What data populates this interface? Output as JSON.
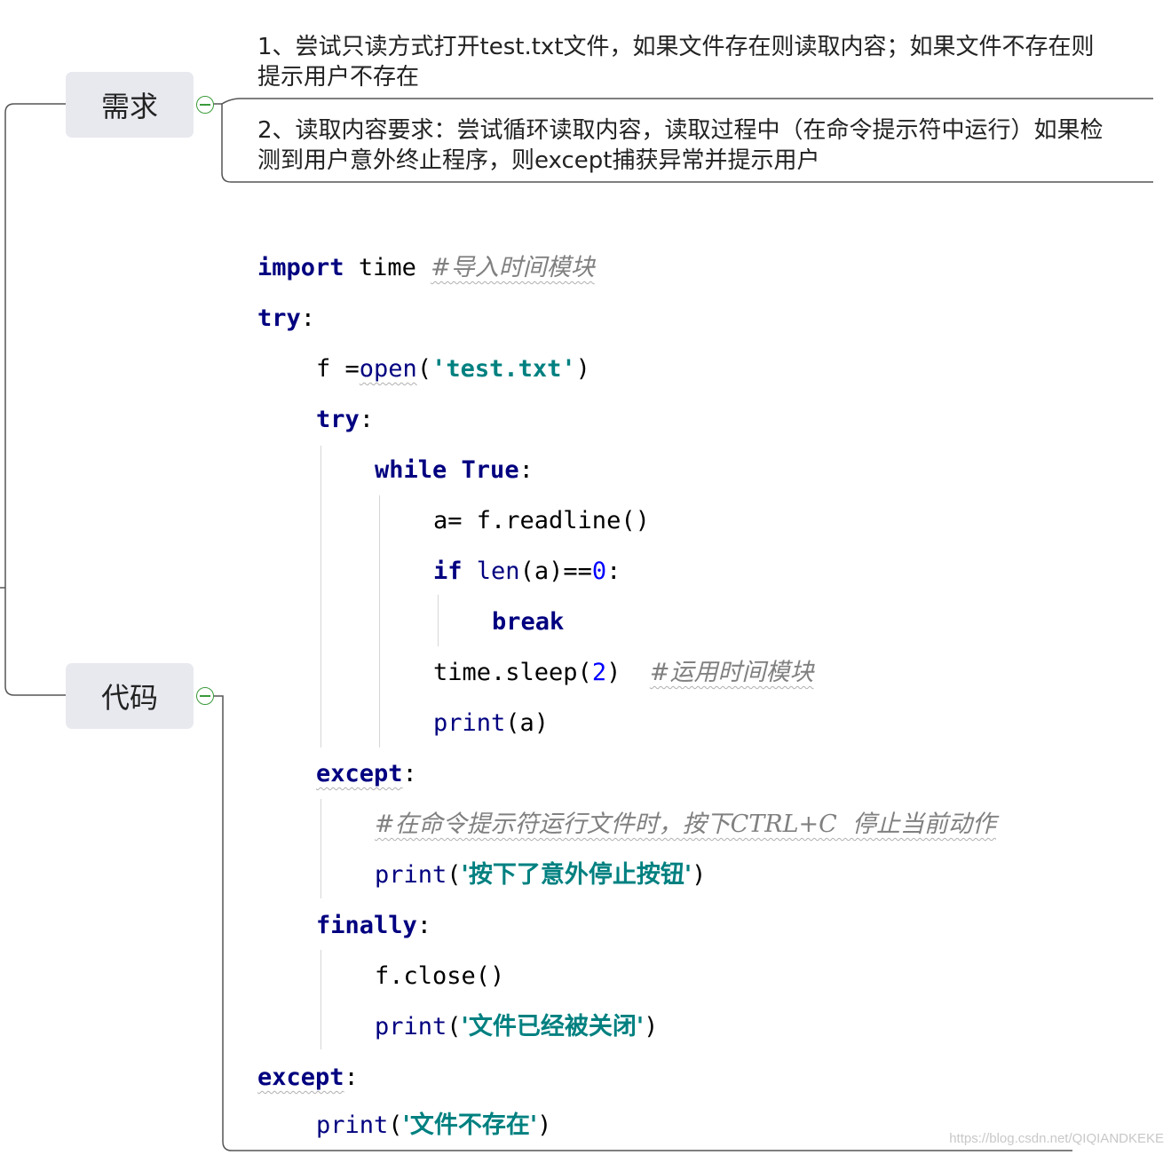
{
  "nodes": {
    "requirements": "需求",
    "code": "代码"
  },
  "requirements": {
    "item1_line1": "1、尝试只读方式打开test.txt文件，如果文件存在则读取内容；如果文件不存在则",
    "item1_line2": "提示用户不存在",
    "item2_line1": "2、读取内容要求：尝试循环读取内容，读取过程中（在命令提示符中运行）如果检",
    "item2_line2": "测到用户意外终止程序，则except捕获异常并提示用户"
  },
  "code": {
    "l1": {
      "kw": "import",
      "mod": "time",
      "comment": "#导入时间模块"
    },
    "l2": {
      "kw": "try",
      "colon": ":"
    },
    "l3": {
      "pre": "f =",
      "fn": "open",
      "open": "(",
      "str": "'test.txt'",
      "close": ")"
    },
    "l4": {
      "kw": "try",
      "colon": ":"
    },
    "l5": {
      "kw1": "while",
      "kw2": "True",
      "colon": ":"
    },
    "l6": {
      "text": "a= f.readline()"
    },
    "l7": {
      "kw": "if",
      "fn": "len",
      "mid": "(a)==",
      "num": "0",
      "colon": ":"
    },
    "l8": {
      "kw": "break"
    },
    "l9": {
      "pre": "time.sleep(",
      "num": "2",
      "close": ")",
      "comment": "#运用时间模块"
    },
    "l10": {
      "fn": "print",
      "rest": "(a)"
    },
    "l11": {
      "kw": "except",
      "colon": ":"
    },
    "l12": {
      "comment": "#在命令提示符运行文件时，按下CTRL+C  停止当前动作"
    },
    "l13": {
      "fn": "print",
      "open": "(",
      "str": "'按下了意外停止按钮'",
      "close": ")"
    },
    "l14": {
      "kw": "finally",
      "colon": ":"
    },
    "l15": {
      "text": "f.close()"
    },
    "l16": {
      "fn": "print",
      "open": "(",
      "str": "'文件已经被关闭'",
      "close": ")"
    },
    "l17": {
      "kw": "except",
      "colon": ":"
    },
    "l18": {
      "fn": "print",
      "open": "(",
      "str": "'文件不存在'",
      "close": ")"
    }
  },
  "watermark": "https://blog.csdn.net/QIQIANDKEKE"
}
